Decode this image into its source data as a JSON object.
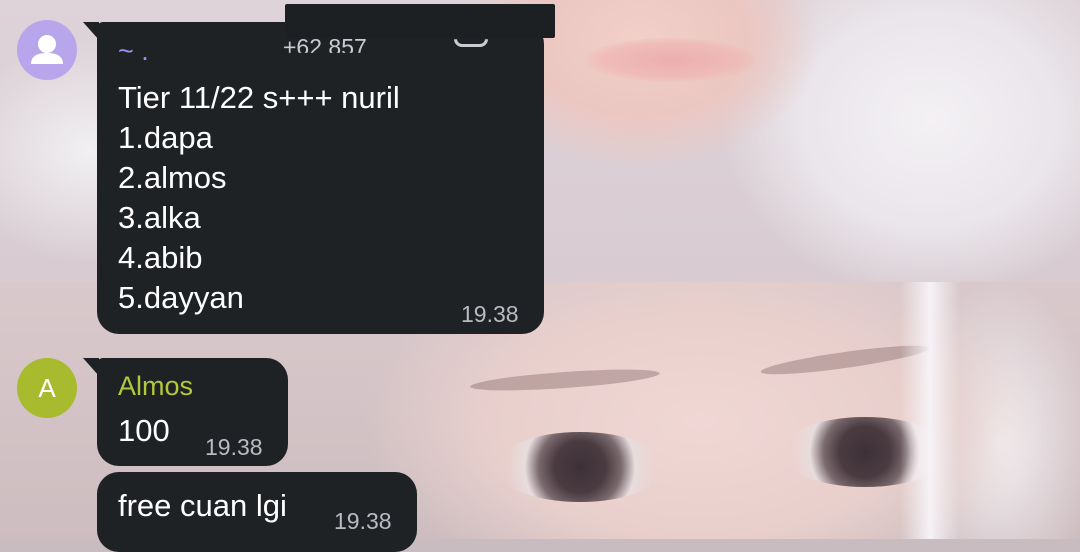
{
  "colors": {
    "bubble": "#1f2225",
    "timestamp": "#b8bcc2",
    "sender_unknown": "#9d8ef0",
    "sender_almos": "#b3c93b",
    "avatar_default": "#b8a6ec",
    "avatar_almos": "#a8ba2e"
  },
  "messages": [
    {
      "sender": "~ .",
      "phone": "+62 857",
      "avatar_icon": "default-user-icon",
      "lines": [
        "Tier 11/22 s+++ nuril",
        "1.dapa",
        "2.almos",
        "3.alka",
        "4.abib",
        "5.dayyan"
      ],
      "time": "19.38"
    },
    {
      "sender": "Almos",
      "avatar_letter": "A",
      "lines": [
        "100"
      ],
      "time": "19.38"
    },
    {
      "lines": [
        "free cuan lgi"
      ],
      "time": "19.38"
    }
  ]
}
